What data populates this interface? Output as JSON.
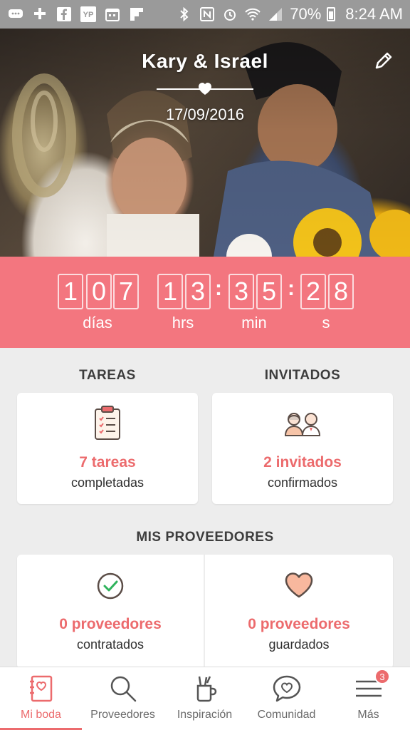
{
  "status_bar": {
    "battery_percent": "70%",
    "time": "8:24 AM",
    "left_icons": [
      "chat-icon",
      "bluetooth-game-icon",
      "facebook-icon",
      "yp-icon",
      "calendar-icon",
      "flipboard-icon"
    ],
    "right_icons": [
      "bluetooth-icon",
      "nfc-icon",
      "alarm-icon",
      "wifi-icon",
      "signal-icon",
      "battery-icon"
    ],
    "yp_label": "YP"
  },
  "hero": {
    "couple_name": "Kary & Israel",
    "wedding_date": "17/09/2016"
  },
  "countdown": {
    "days": [
      "1",
      "0",
      "7"
    ],
    "hours": [
      "1",
      "3"
    ],
    "minutes": [
      "3",
      "5"
    ],
    "seconds": [
      "2",
      "8"
    ],
    "labels": {
      "days": "días",
      "hours": "hrs",
      "minutes": "min",
      "seconds": "s"
    },
    "separator": ":"
  },
  "tasks": {
    "title": "TAREAS",
    "main": "7 tareas",
    "sub": "completadas"
  },
  "guests": {
    "title": "INVITADOS",
    "main": "2 invitados",
    "sub": "confirmados"
  },
  "vendors": {
    "title": "MIS PROVEEDORES",
    "hired": {
      "main": "0 proveedores",
      "sub": "contratados"
    },
    "saved": {
      "main": "0 proveedores",
      "sub": "guardados"
    }
  },
  "nav": {
    "items": [
      {
        "label": "Mi boda",
        "icon": "notebook-icon",
        "active": true
      },
      {
        "label": "Proveedores",
        "icon": "search-icon",
        "active": false
      },
      {
        "label": "Inspiración",
        "icon": "inspiration-cup-icon",
        "active": false
      },
      {
        "label": "Comunidad",
        "icon": "chat-heart-icon",
        "active": false
      },
      {
        "label": "Más",
        "icon": "menu-icon",
        "active": false,
        "badge": "3"
      }
    ]
  },
  "colors": {
    "accent": "#ec6b6d",
    "countdown_bg": "#f3767f",
    "status_bar": "#9a9a9a",
    "page_bg": "#ededed"
  }
}
